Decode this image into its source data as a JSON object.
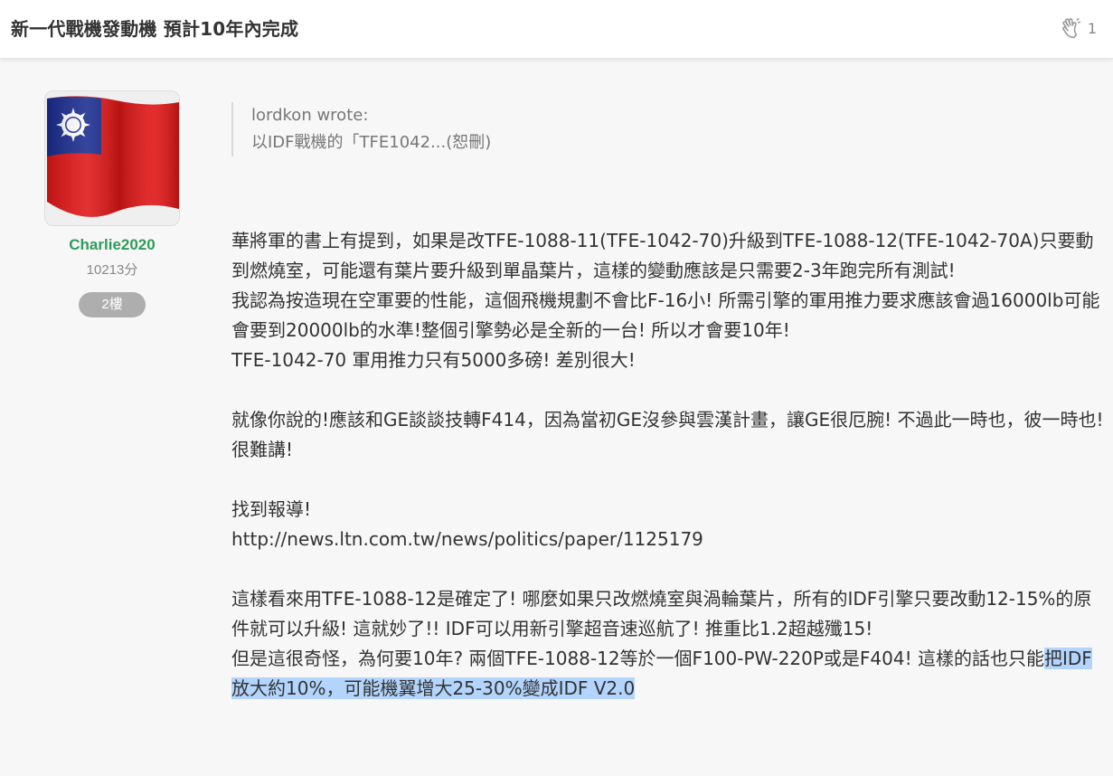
{
  "header": {
    "title": "新一代戰機發動機 預計10年內完成",
    "like_count": "1"
  },
  "author": {
    "name": "Charlie2020",
    "points": "10213分",
    "floor": "2樓"
  },
  "quote": {
    "by": "lordkon wrote:",
    "text": "以IDF戰機的「TFE1042...(恕刪)"
  },
  "post": {
    "p1": "華將軍的書上有提到，如果是改TFE-1088-11(TFE-1042-70)升級到TFE-1088-12(TFE-1042-70A)只要動到燃燒室，可能還有葉片要升級到單晶葉片，這樣的變動應該是只需要2-3年跑完所有測試!",
    "p2": "我認為按造現在空軍要的性能，這個飛機規劃不會比F-16小! 所需引擎的軍用推力要求應該會過16000lb可能會要到20000lb的水準!整個引擎勢必是全新的一台! 所以才會要10年!",
    "p3": "TFE-1042-70 軍用推力只有5000多磅! 差別很大!",
    "p4": "就像你說的!應該和GE談談技轉F414，因為當初GE沒參與雲漢計畫，讓GE很厄腕! 不過此一時也，彼一時也! 很難講!",
    "p5": "找到報導!",
    "link": "http://news.ltn.com.tw/news/politics/paper/1125179",
    "p6": "這樣看來用TFE-1088-12是確定了! 哪麼如果只改燃燒室與渦輪葉片，所有的IDF引擎只要改動12-15%的原件就可以升級! 這就妙了!! IDF可以用新引擎超音速巡航了! 推重比1.2超越殲15!",
    "p7_plain": "但是這很奇怪，為何要10年? 兩個TFE-1088-12等於一個F100-PW-220P或是F404! 這樣的話也只能",
    "p7_highlight": "把IDF放大約10%，可能機翼增大25-30%變成IDF V2.0"
  },
  "colors": {
    "author_name": "#2f9b5a",
    "badge_bg": "#aeaeae",
    "selection": "#b3d4fc"
  },
  "icons": {
    "like": "clap-hand-icon",
    "avatar": "taiwan-flag-avatar"
  }
}
